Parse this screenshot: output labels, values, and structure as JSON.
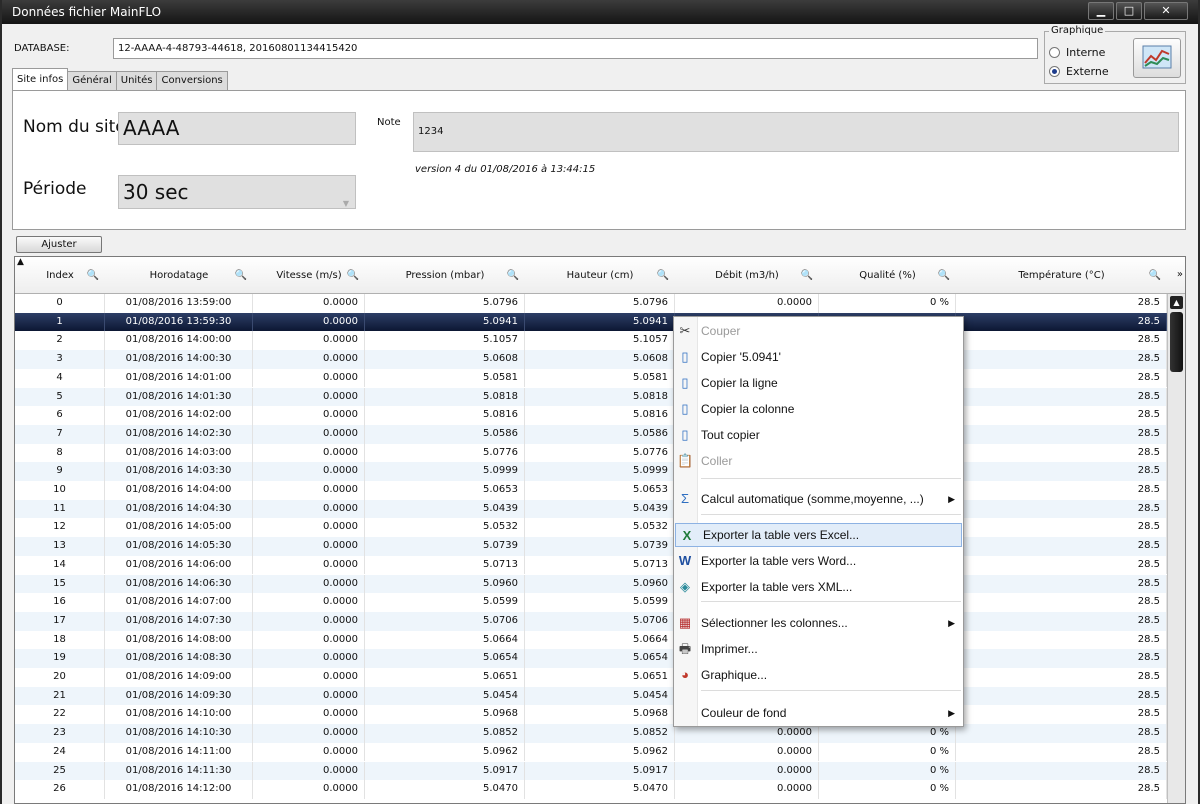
{
  "window": {
    "title": "Données fichier MainFLO",
    "min_icon": "minimize-icon",
    "max_icon": "maximize-icon",
    "close_icon": "close-icon"
  },
  "database": {
    "label": "DATABASE:",
    "value": "12-AAAA-4-48793-44618, 20160801134415420"
  },
  "graphique": {
    "legend": "Graphique",
    "options": [
      {
        "label": "Interne",
        "selected": false
      },
      {
        "label": "Externe",
        "selected": true
      }
    ],
    "button_icon": "chart-icon"
  },
  "tabs": [
    "Site infos",
    "Général",
    "Unités",
    "Conversions"
  ],
  "site": {
    "nom_label": "Nom du site",
    "nom_value": "AAAA",
    "periode_label": "Période",
    "periode_value": "30 sec",
    "note_label": "Note",
    "note_value": "1234",
    "version": "version 4 du 01/08/2016 à 13:44:15"
  },
  "ajuster_label": "Ajuster",
  "table": {
    "columns": [
      "Index",
      "Horodatage",
      "Vitesse (m/s)",
      "Pression (mbar)",
      "Hauteur (cm)",
      "Débit (m3/h)",
      "Qualité (%)",
      "Température (°C)"
    ],
    "selected_index": 1,
    "rows": [
      [
        "0",
        "01/08/2016 13:59:00",
        "0.0000",
        "5.0796",
        "5.0796",
        "0.0000",
        "0 %",
        "28.5"
      ],
      [
        "1",
        "01/08/2016 13:59:30",
        "0.0000",
        "5.0941",
        "5.0941",
        "",
        "",
        "28.5"
      ],
      [
        "2",
        "01/08/2016 14:00:00",
        "0.0000",
        "5.1057",
        "5.1057",
        "",
        "",
        "28.5"
      ],
      [
        "3",
        "01/08/2016 14:00:30",
        "0.0000",
        "5.0608",
        "5.0608",
        "",
        "",
        "28.5"
      ],
      [
        "4",
        "01/08/2016 14:01:00",
        "0.0000",
        "5.0581",
        "5.0581",
        "",
        "",
        "28.5"
      ],
      [
        "5",
        "01/08/2016 14:01:30",
        "0.0000",
        "5.0818",
        "5.0818",
        "",
        "",
        "28.5"
      ],
      [
        "6",
        "01/08/2016 14:02:00",
        "0.0000",
        "5.0816",
        "5.0816",
        "",
        "",
        "28.5"
      ],
      [
        "7",
        "01/08/2016 14:02:30",
        "0.0000",
        "5.0586",
        "5.0586",
        "",
        "",
        "28.5"
      ],
      [
        "8",
        "01/08/2016 14:03:00",
        "0.0000",
        "5.0776",
        "5.0776",
        "",
        "",
        "28.5"
      ],
      [
        "9",
        "01/08/2016 14:03:30",
        "0.0000",
        "5.0999",
        "5.0999",
        "",
        "",
        "28.5"
      ],
      [
        "10",
        "01/08/2016 14:04:00",
        "0.0000",
        "5.0653",
        "5.0653",
        "",
        "",
        "28.5"
      ],
      [
        "11",
        "01/08/2016 14:04:30",
        "0.0000",
        "5.0439",
        "5.0439",
        "",
        "",
        "28.5"
      ],
      [
        "12",
        "01/08/2016 14:05:00",
        "0.0000",
        "5.0532",
        "5.0532",
        "",
        "",
        "28.5"
      ],
      [
        "13",
        "01/08/2016 14:05:30",
        "0.0000",
        "5.0739",
        "5.0739",
        "",
        "",
        "28.5"
      ],
      [
        "14",
        "01/08/2016 14:06:00",
        "0.0000",
        "5.0713",
        "5.0713",
        "",
        "",
        "28.5"
      ],
      [
        "15",
        "01/08/2016 14:06:30",
        "0.0000",
        "5.0960",
        "5.0960",
        "",
        "",
        "28.5"
      ],
      [
        "16",
        "01/08/2016 14:07:00",
        "0.0000",
        "5.0599",
        "5.0599",
        "",
        "",
        "28.5"
      ],
      [
        "17",
        "01/08/2016 14:07:30",
        "0.0000",
        "5.0706",
        "5.0706",
        "",
        "",
        "28.5"
      ],
      [
        "18",
        "01/08/2016 14:08:00",
        "0.0000",
        "5.0664",
        "5.0664",
        "",
        "",
        "28.5"
      ],
      [
        "19",
        "01/08/2016 14:08:30",
        "0.0000",
        "5.0654",
        "5.0654",
        "",
        "",
        "28.5"
      ],
      [
        "20",
        "01/08/2016 14:09:00",
        "0.0000",
        "5.0651",
        "5.0651",
        "",
        "",
        "28.5"
      ],
      [
        "21",
        "01/08/2016 14:09:30",
        "0.0000",
        "5.0454",
        "5.0454",
        "",
        "",
        "28.5"
      ],
      [
        "22",
        "01/08/2016 14:10:00",
        "0.0000",
        "5.0968",
        "5.0968",
        "",
        "",
        "28.5"
      ],
      [
        "23",
        "01/08/2016 14:10:30",
        "0.0000",
        "5.0852",
        "5.0852",
        "0.0000",
        "0 %",
        "28.5"
      ],
      [
        "24",
        "01/08/2016 14:11:00",
        "0.0000",
        "5.0962",
        "5.0962",
        "0.0000",
        "0 %",
        "28.5"
      ],
      [
        "25",
        "01/08/2016 14:11:30",
        "0.0000",
        "5.0917",
        "5.0917",
        "0.0000",
        "0 %",
        "28.5"
      ],
      [
        "26",
        "01/08/2016 14:12:00",
        "0.0000",
        "5.0470",
        "5.0470",
        "0.0000",
        "0 %",
        "28.5"
      ]
    ]
  },
  "context_menu": {
    "items": [
      {
        "label": "Couper",
        "icon": "scissors-icon",
        "disabled": true
      },
      {
        "label": "Copier '5.0941'",
        "icon": "copy-icon"
      },
      {
        "label": "Copier la ligne",
        "icon": "copy-row-icon"
      },
      {
        "label": "Copier la colonne",
        "icon": "copy-column-icon"
      },
      {
        "label": "Tout copier",
        "icon": "copy-all-icon"
      },
      {
        "label": "Coller",
        "icon": "paste-icon",
        "disabled": true
      },
      {
        "label": "Calcul automatique (somme,moyenne, ...)",
        "icon": "sigma-icon",
        "submenu": true
      },
      {
        "label": "Exporter la table vers Excel...",
        "icon": "excel-icon",
        "highlighted": true
      },
      {
        "label": "Exporter la table vers Word...",
        "icon": "word-icon"
      },
      {
        "label": "Exporter la table vers XML...",
        "icon": "xml-icon"
      },
      {
        "label": "Sélectionner les colonnes...",
        "icon": "columns-icon",
        "submenu": true
      },
      {
        "label": "Imprimer...",
        "icon": "printer-icon"
      },
      {
        "label": "Graphique...",
        "icon": "chart-icon"
      },
      {
        "label": "Couleur de fond",
        "icon": "",
        "submenu": true
      }
    ]
  }
}
